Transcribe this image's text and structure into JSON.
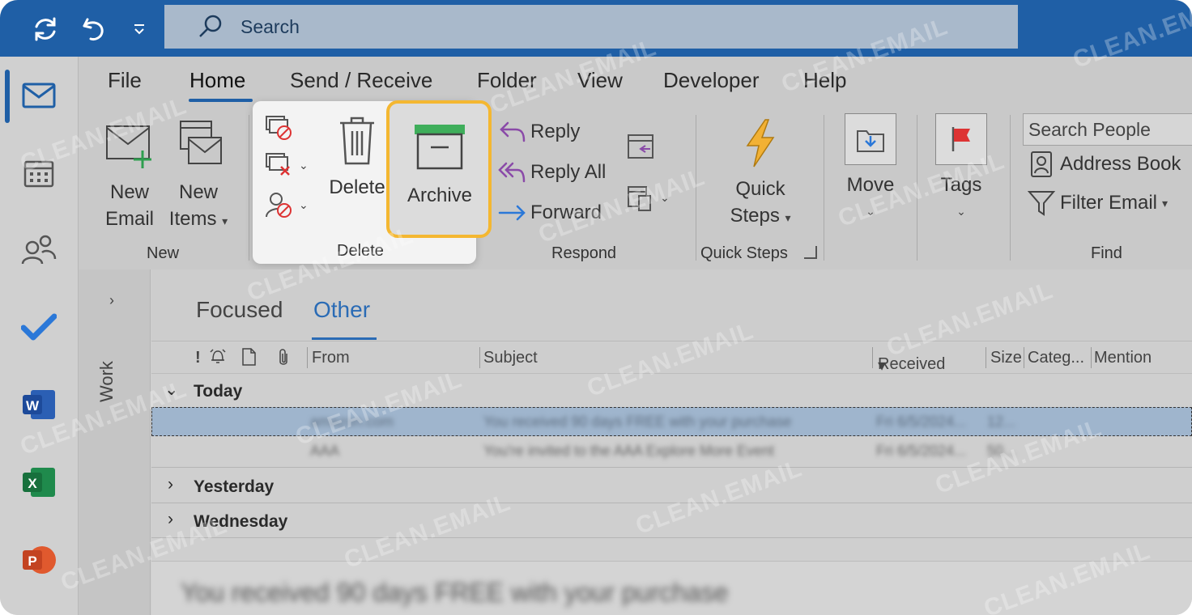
{
  "title_bar": {
    "search_placeholder": "Search"
  },
  "ribbon": {
    "tabs": [
      "File",
      "Home",
      "Send / Receive",
      "Folder",
      "View",
      "Developer",
      "Help"
    ],
    "groups": {
      "new": {
        "label": "New",
        "new_email": [
          "New",
          "Email"
        ],
        "new_items": [
          "New",
          "Items"
        ]
      },
      "delete": {
        "label": "Delete",
        "delete_btn": "Delete",
        "archive_btn": "Archive"
      },
      "respond": {
        "label": "Respond",
        "reply": "Reply",
        "reply_all": "Reply All",
        "forward": "Forward"
      },
      "quick_steps": {
        "label": "Quick Steps",
        "button": [
          "Quick",
          "Steps"
        ]
      },
      "move": {
        "label": "Move"
      },
      "tags": {
        "label": "Tags"
      },
      "find": {
        "label": "Find",
        "search_people_placeholder": "Search People",
        "address_book": "Address Book",
        "filter_email": "Filter Email"
      }
    }
  },
  "folder_pane": {
    "label": "Work"
  },
  "mail_list": {
    "tabs": [
      "Focused",
      "Other"
    ],
    "columns": {
      "from": "From",
      "subject": "Subject",
      "received": "Received",
      "size": "Size",
      "categories": "Categ...",
      "mention": "Mention"
    },
    "groups": [
      "Today",
      "Yesterday",
      "Wednesday"
    ],
    "rows": [
      {
        "from": "amazon.com",
        "subject": "You received 90 days FREE with your purchase",
        "received": "Fri 6/5/2024...",
        "size": "12..."
      },
      {
        "from": "AAA",
        "subject": "You're invited to the AAA Explore More Event",
        "received": "Fri 6/5/2024...",
        "size": "50..."
      }
    ],
    "preview_subject": "You received 90 days FREE with your purchase"
  },
  "watermark": "CLEAN.EMAIL",
  "colors": {
    "title_bar": "#1f5fa6",
    "accent": "#1f5fa6",
    "highlight": "#f4b731"
  }
}
